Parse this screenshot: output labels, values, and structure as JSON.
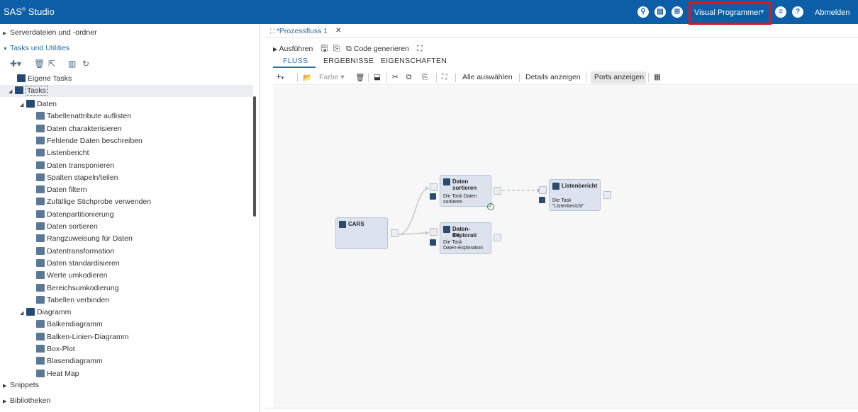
{
  "header": {
    "app_title": "SAS",
    "app_title_suffix": "Studio",
    "app_title_reg": "®",
    "perspective": "Visual Programmer",
    "logout": "Abmelden",
    "icons": [
      "search-icon",
      "printer-icon",
      "grid-icon",
      "menu-icon",
      "help-icon"
    ]
  },
  "left": {
    "server_files": "Serverdateien und -ordner",
    "tasks_utilities": "Tasks und Utilities",
    "my_tasks": "Eigene Tasks",
    "tasks": "Tasks",
    "tree": [
      {
        "label": "Daten",
        "level": 1,
        "type": "folder",
        "expanded": true
      },
      {
        "label": "Tabellenattribute auflisten",
        "level": 2
      },
      {
        "label": "Daten charakterisieren",
        "level": 2
      },
      {
        "label": "Fehlende Daten beschreiben",
        "level": 2
      },
      {
        "label": "Listenbericht",
        "level": 2
      },
      {
        "label": "Daten transponieren",
        "level": 2
      },
      {
        "label": "Spalten stapeln/teilen",
        "level": 2
      },
      {
        "label": "Daten filtern",
        "level": 2
      },
      {
        "label": "Zufällige Stichprobe verwenden",
        "level": 2
      },
      {
        "label": "Datenpartitionierung",
        "level": 2
      },
      {
        "label": "Daten sortieren",
        "level": 2
      },
      {
        "label": "Rangzuweisung für Daten",
        "level": 2
      },
      {
        "label": "Datentransformation",
        "level": 2
      },
      {
        "label": "Daten standardisieren",
        "level": 2
      },
      {
        "label": "Werte umkodieren",
        "level": 2
      },
      {
        "label": "Bereichsumkodierung",
        "level": 2
      },
      {
        "label": "Tabellen verbinden",
        "level": 2
      },
      {
        "label": "Diagramm",
        "level": 1,
        "type": "folder",
        "expanded": true
      },
      {
        "label": "Balkendiagramm",
        "level": 2
      },
      {
        "label": "Balken-Linien-Diagramm",
        "level": 2
      },
      {
        "label": "Box-Plot",
        "level": 2
      },
      {
        "label": "Blasendiagramm",
        "level": 2
      },
      {
        "label": "Heat Map",
        "level": 2
      }
    ],
    "snippets": "Snippets",
    "libraries": "Bibliotheken"
  },
  "editor": {
    "doc_tab": "*Prozessfluss 1",
    "run": "Ausführen",
    "generate_code": "Code generieren",
    "subtabs": [
      "FLUSS",
      "ERGEBNISSE",
      "EIGENSCHAFTEN"
    ],
    "color": "Farbe",
    "select_all": "Alle auswählen",
    "show_details": "Details anzeigen",
    "show_ports": "Ports anzeigen"
  },
  "flow": {
    "nodes": {
      "cars": {
        "title": "CARS"
      },
      "sort": {
        "title": "Daten sortieren",
        "desc1": "Die Task Daten",
        "desc2": "sortieren"
      },
      "explore": {
        "title1": "Daten-Explorati",
        "title2": "on",
        "desc1": "Die Task",
        "desc2": "Daten-Exploration"
      },
      "list": {
        "title": "Listenbericht",
        "desc1": "Die Task",
        "desc2": "\"Listenbericht\""
      }
    }
  },
  "colors": {
    "header": "#0c5ea6",
    "accent": "#2b6ca3",
    "highlight": "#e0161d",
    "success": "#2e8b2e"
  }
}
